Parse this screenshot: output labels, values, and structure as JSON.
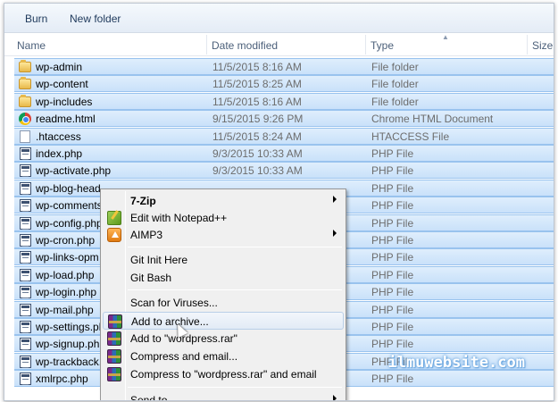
{
  "toolbar": {
    "burn_label": "Burn",
    "new_folder_label": "New folder"
  },
  "columns": {
    "name": "Name",
    "date": "Date modified",
    "type": "Type",
    "size": "Size"
  },
  "files": [
    {
      "name": "wp-admin",
      "date": "11/5/2015 8:16 AM",
      "type": "File folder",
      "icon": "folder-icon"
    },
    {
      "name": "wp-content",
      "date": "11/5/2015 8:25 AM",
      "type": "File folder",
      "icon": "folder-icon"
    },
    {
      "name": "wp-includes",
      "date": "11/5/2015 8:16 AM",
      "type": "File folder",
      "icon": "folder-icon"
    },
    {
      "name": "readme.html",
      "date": "9/15/2015 9:26 PM",
      "type": "Chrome HTML Document",
      "icon": "chrome-icon"
    },
    {
      "name": ".htaccess",
      "date": "11/5/2015 8:24 AM",
      "type": "HTACCESS File",
      "icon": "file-icon"
    },
    {
      "name": "index.php",
      "date": "9/3/2015 10:33 AM",
      "type": "PHP File",
      "icon": "php-file-icon"
    },
    {
      "name": "wp-activate.php",
      "date": "9/3/2015 10:33 AM",
      "type": "PHP File",
      "icon": "php-file-icon"
    },
    {
      "name": "wp-blog-head",
      "date": "",
      "type": "PHP File",
      "icon": "php-file-icon"
    },
    {
      "name": "wp-comments",
      "date": "",
      "type": "PHP File",
      "icon": "php-file-icon"
    },
    {
      "name": "wp-config.php",
      "date": "",
      "type": "PHP File",
      "icon": "php-file-icon"
    },
    {
      "name": "wp-cron.php",
      "date": "",
      "type": "PHP File",
      "icon": "php-file-icon"
    },
    {
      "name": "wp-links-opm",
      "date": "",
      "type": "PHP File",
      "icon": "php-file-icon"
    },
    {
      "name": "wp-load.php",
      "date": "",
      "type": "PHP File",
      "icon": "php-file-icon"
    },
    {
      "name": "wp-login.php",
      "date": "",
      "type": "PHP File",
      "icon": "php-file-icon"
    },
    {
      "name": "wp-mail.php",
      "date": "",
      "type": "PHP File",
      "icon": "php-file-icon"
    },
    {
      "name": "wp-settings.ph",
      "date": "",
      "type": "PHP File",
      "icon": "php-file-icon"
    },
    {
      "name": "wp-signup.ph",
      "date": "",
      "type": "PHP File",
      "icon": "php-file-icon"
    },
    {
      "name": "wp-trackback.",
      "date": "",
      "type": "PHP File",
      "icon": "php-file-icon"
    },
    {
      "name": "xmlrpc.php",
      "date": "",
      "type": "PHP File",
      "icon": "php-file-icon"
    }
  ],
  "context_menu": {
    "items": [
      {
        "label": "7-Zip",
        "bold": true,
        "submenu": true,
        "icon": ""
      },
      {
        "label": "Edit with Notepad++",
        "icon": "notepad-plus-plus-icon"
      },
      {
        "label": "AIMP3",
        "submenu": true,
        "icon": "aimp-icon"
      },
      {
        "label": "Git Init Here",
        "icon": ""
      },
      {
        "label": "Git Bash",
        "icon": ""
      },
      {
        "label": "Scan for Viruses...",
        "icon": ""
      },
      {
        "label": "Add to archive...",
        "icon": "winrar-icon",
        "hovered": true
      },
      {
        "label": "Add to \"wordpress.rar\"",
        "icon": "winrar-icon"
      },
      {
        "label": "Compress and email...",
        "icon": "winrar-icon"
      },
      {
        "label": "Compress to \"wordpress.rar\" and email",
        "icon": "winrar-icon"
      },
      {
        "label": "Send to",
        "submenu": true,
        "icon": ""
      }
    ]
  },
  "watermark": "ilmuwebsite.com"
}
